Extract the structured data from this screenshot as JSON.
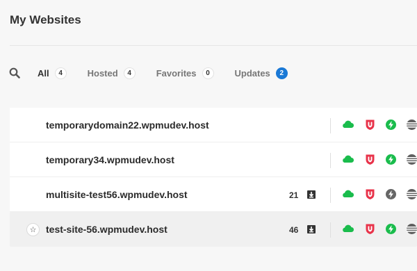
{
  "page": {
    "title": "My Websites"
  },
  "filters": {
    "tabs": [
      {
        "label": "All",
        "count": "4"
      },
      {
        "label": "Hosted",
        "count": "4"
      },
      {
        "label": "Favorites",
        "count": "0"
      },
      {
        "label": "Updates",
        "count": "2"
      }
    ]
  },
  "sites": [
    {
      "name": "temporarydomain22.wpmudev.host",
      "updates": "",
      "favorite": false,
      "speed_active": true
    },
    {
      "name": "temporary34.wpmudev.host",
      "updates": "",
      "favorite": false,
      "speed_active": true
    },
    {
      "name": "multisite-test56.wpmudev.host",
      "updates": "21",
      "favorite": false,
      "speed_active": false
    },
    {
      "name": "test-site-56.wpmudev.host",
      "updates": "46",
      "favorite": true,
      "speed_active": true
    }
  ],
  "icons": {
    "search": "search-icon",
    "star": "☆",
    "updates": "download-icon",
    "hosting": "cloud-icon",
    "defender": "shield-icon",
    "speed": "lightning-icon",
    "server": "server-icon"
  },
  "colors": {
    "green": "#1abc4c",
    "red": "#e8334a",
    "gray": "#666666",
    "blue_badge": "#1a79d6"
  }
}
